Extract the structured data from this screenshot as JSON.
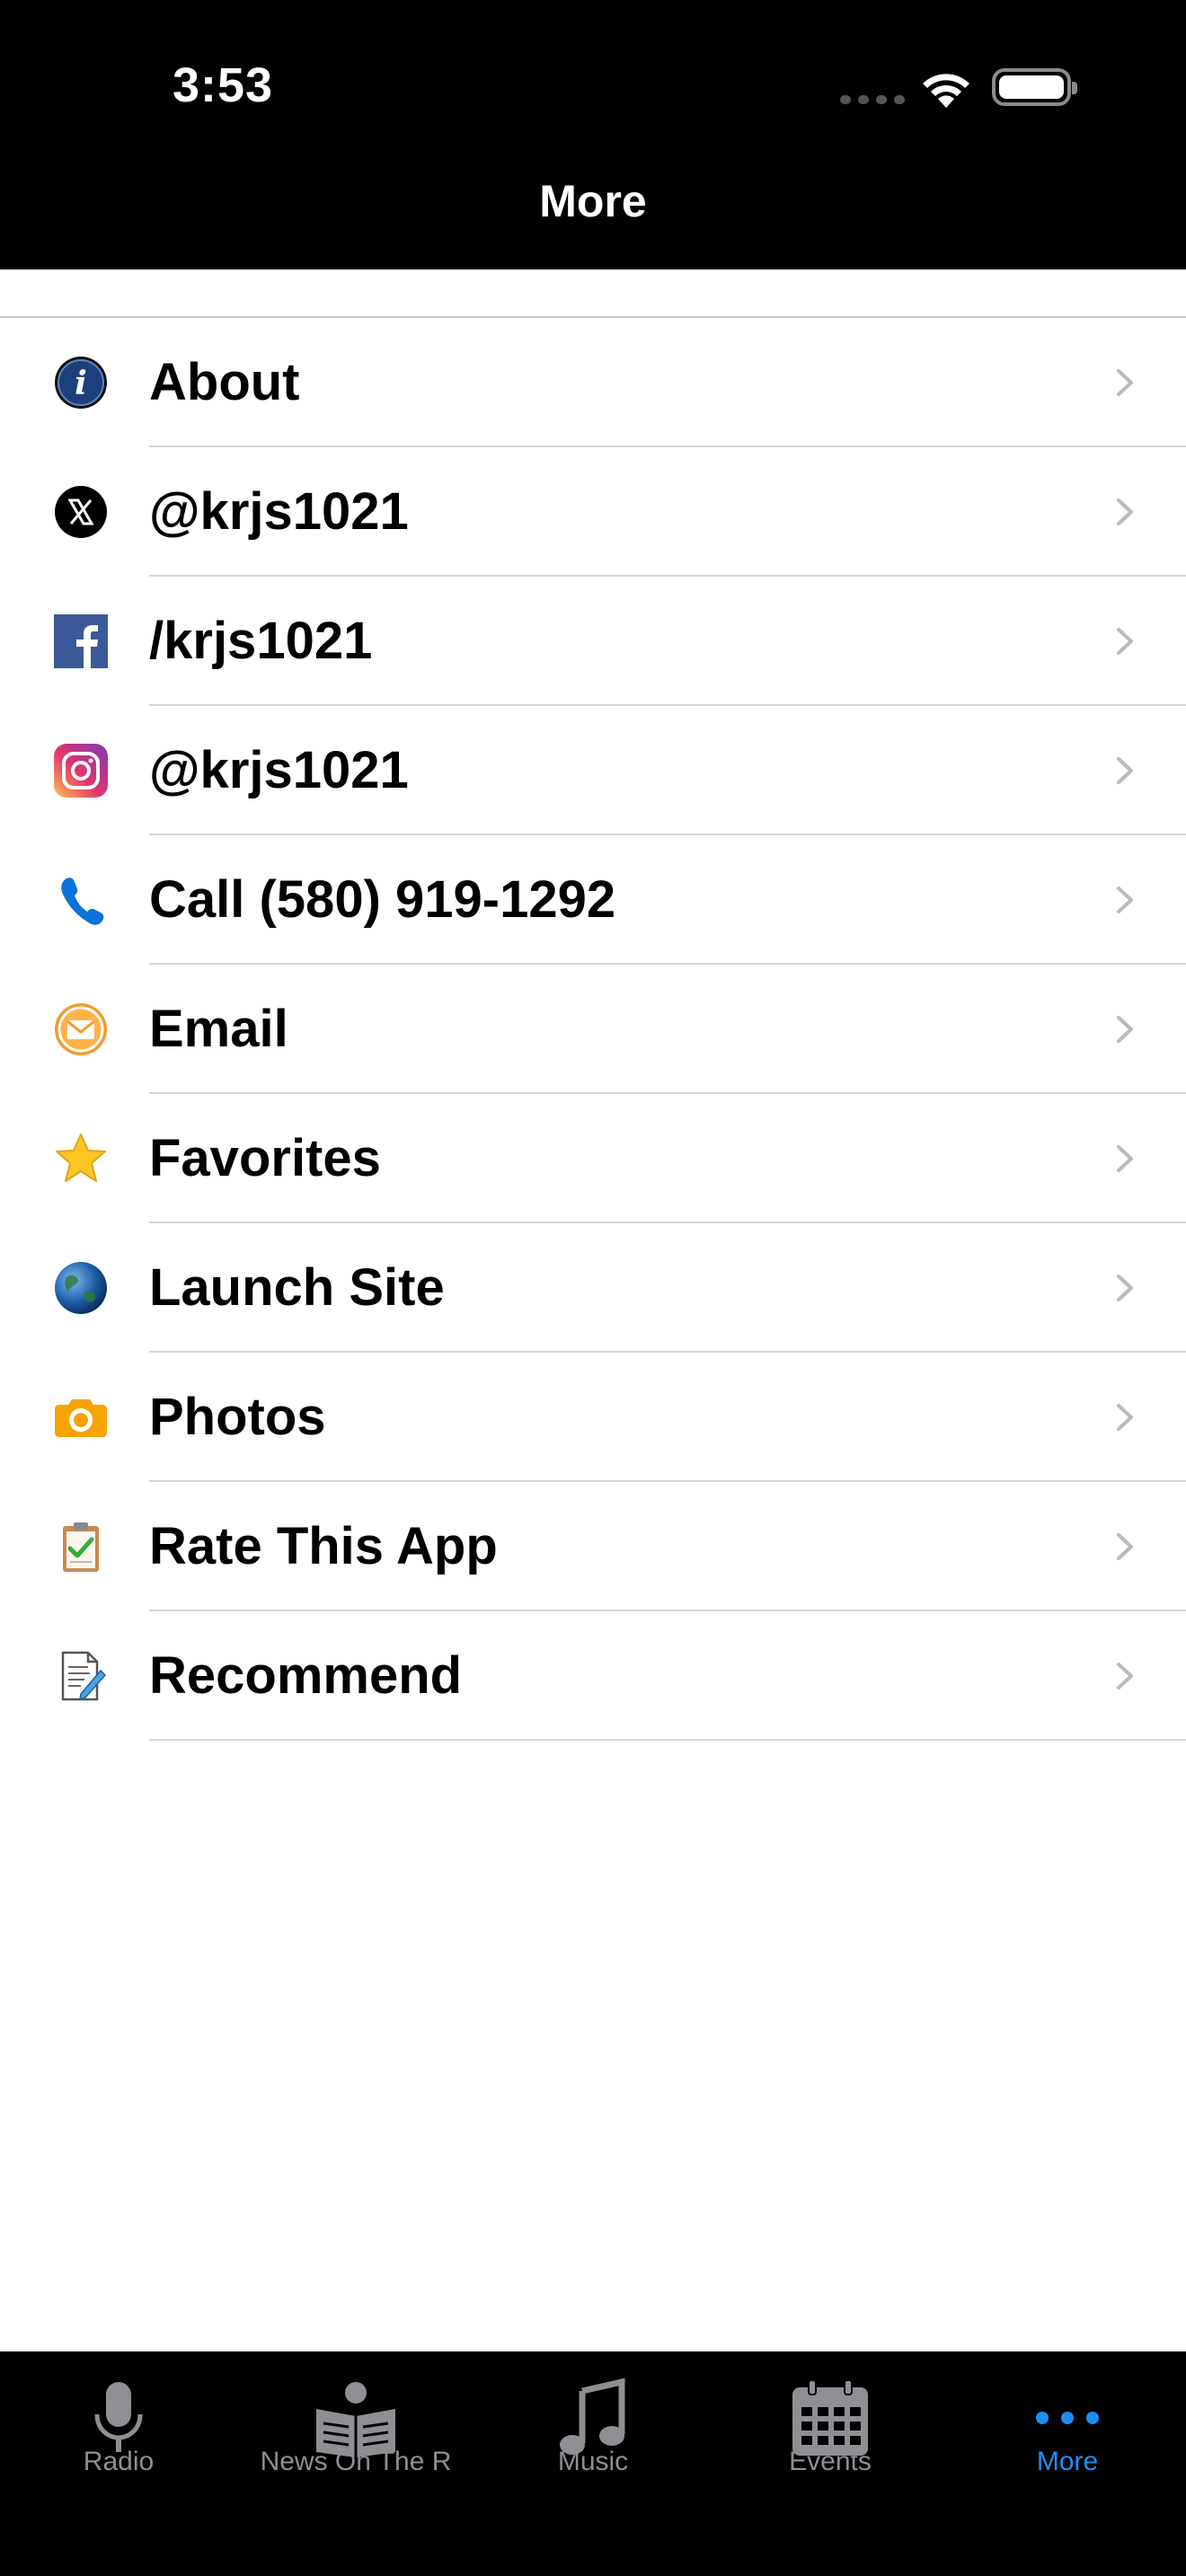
{
  "status_bar": {
    "time": "3:53"
  },
  "nav": {
    "title": "More"
  },
  "menu": [
    {
      "label": "About",
      "icon": "info-icon"
    },
    {
      "label": "@krjs1021",
      "icon": "x-logo-icon"
    },
    {
      "label": "/krjs1021",
      "icon": "facebook-icon"
    },
    {
      "label": "@krjs1021",
      "icon": "instagram-icon"
    },
    {
      "label": "Call (580) 919-1292",
      "icon": "phone-icon"
    },
    {
      "label": "Email",
      "icon": "envelope-icon"
    },
    {
      "label": "Favorites",
      "icon": "star-icon"
    },
    {
      "label": "Launch Site",
      "icon": "globe-icon"
    },
    {
      "label": "Photos",
      "icon": "camera-icon"
    },
    {
      "label": "Rate This App",
      "icon": "clipboard-check-icon"
    },
    {
      "label": "Recommend",
      "icon": "document-pencil-icon"
    }
  ],
  "tabs": [
    {
      "label": "Radio",
      "icon": "microphone-icon"
    },
    {
      "label": "News On The R",
      "icon": "newspaper-icon"
    },
    {
      "label": "Music",
      "icon": "music-note-icon"
    },
    {
      "label": "Events",
      "icon": "calendar-icon"
    },
    {
      "label": "More",
      "icon": "more-dots-icon",
      "active": true
    }
  ],
  "colors": {
    "accent": "#1e8ff0",
    "bar_background": "#000000",
    "inactive_tab": "#8e8e93"
  }
}
